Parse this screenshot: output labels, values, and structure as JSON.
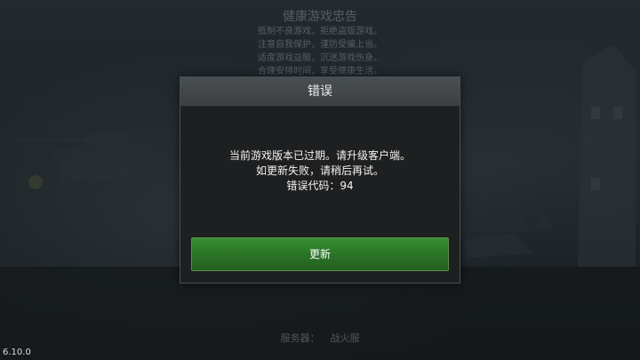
{
  "background": {
    "notice": {
      "title": "健康游戏忠告",
      "lines": [
        "抵制不良游戏，拒绝盗版游戏。",
        "注意自我保护，谨防受骗上当。",
        "适度游戏益脑，沉迷游戏伤身。",
        "合理安排时间，享受健康生活。"
      ]
    },
    "server": {
      "label": "服务器：",
      "name": "战火服"
    },
    "version": "6.10.0"
  },
  "dialog": {
    "title": "错误",
    "message_lines": [
      "当前游戏版本已过期。请升级客户端。",
      "如更新失败，请稍后再试。",
      "错误代码：94"
    ],
    "button_label": "更新"
  },
  "colors": {
    "dialog_bg": "#1e1f20",
    "header_bg": "#44494c",
    "button_green": "#2e7a28"
  }
}
